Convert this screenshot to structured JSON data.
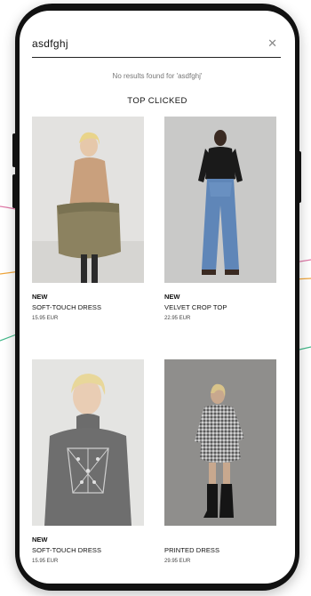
{
  "search": {
    "query": "asdfghj",
    "no_results": "No results found for 'asdfghj'"
  },
  "section_title": "TOP CLICKED",
  "products": [
    {
      "tag": "NEW",
      "name": "SOFT-TOUCH DRESS",
      "price": "15.95 EUR",
      "image_icon": "model-camel-dress-bag"
    },
    {
      "tag": "NEW",
      "name": "VELVET CROP TOP",
      "price": "22.95 EUR",
      "image_icon": "model-black-top-jeans"
    },
    {
      "tag": "NEW",
      "name": "SOFT-TOUCH DRESS",
      "price": "15.95 EUR",
      "image_icon": "model-grey-knit-dress"
    },
    {
      "tag": "",
      "name": "PRINTED DRESS",
      "price": "29.95 EUR",
      "image_icon": "model-gingham-dress-boots"
    }
  ],
  "colors": {
    "frame": "#111111",
    "deco_pink": "#e07aa8",
    "deco_orange": "#f0a63c",
    "deco_green": "#44b98a"
  }
}
